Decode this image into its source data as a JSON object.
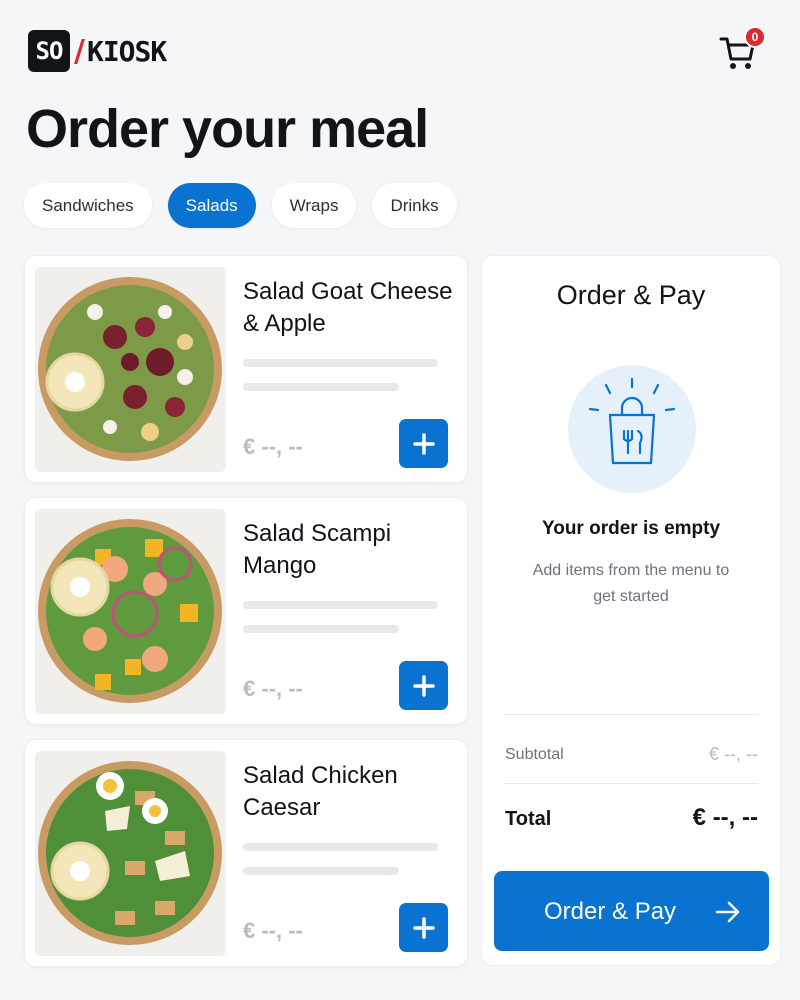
{
  "header": {
    "logo_left": "SO",
    "logo_right": "KIOSK",
    "cart_count": "0"
  },
  "page_title": "Order your meal",
  "tabs": [
    {
      "label": "Sandwiches",
      "active": false
    },
    {
      "label": "Salads",
      "active": true
    },
    {
      "label": "Wraps",
      "active": false
    },
    {
      "label": "Drinks",
      "active": false
    }
  ],
  "products": [
    {
      "name": "Salad Goat Cheese & Apple",
      "price": "€ --, --"
    },
    {
      "name": "Salad Scampi Mango",
      "price": "€ --, --"
    },
    {
      "name": "Salad Chicken Caesar",
      "price": "€ --, --"
    }
  ],
  "order_panel": {
    "title": "Order & Pay",
    "empty_title": "Your order is empty",
    "empty_subtitle": "Add items from the menu to get started",
    "subtotal_label": "Subtotal",
    "subtotal_value": "€ --, --",
    "total_label": "Total",
    "total_value": "€ --, --",
    "pay_button": "Order & Pay"
  },
  "colors": {
    "accent": "#0a72d1",
    "badge": "#e2282f",
    "background": "#f5f6f8"
  }
}
